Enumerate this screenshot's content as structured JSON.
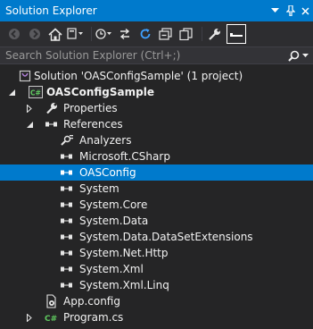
{
  "window": {
    "title": "Solution Explorer",
    "controls": [
      "dropdown-icon",
      "pin-icon",
      "close-icon"
    ]
  },
  "toolbar": {
    "buttons": [
      "back-icon",
      "forward-icon",
      "home-icon",
      "switch-views-icon",
      "pending-changes-filter-icon",
      "sync-icon",
      "refresh-icon",
      "collapse-all-icon",
      "show-all-files-icon",
      "properties-icon",
      "preview-icon"
    ]
  },
  "search": {
    "placeholder": "Search Solution Explorer (Ctrl+;)"
  },
  "tree": [
    {
      "label": "Solution 'OASConfigSample' (1 project)",
      "icon": "solution-icon",
      "level": 0,
      "expander": ""
    },
    {
      "label": "OASConfigSample",
      "icon": "csharp-project-icon",
      "level": 0,
      "expander": "expanded",
      "bold": true
    },
    {
      "label": "Properties",
      "icon": "wrench-icon",
      "level": 1,
      "expander": "collapsed"
    },
    {
      "label": "References",
      "icon": "references-icon",
      "level": 1,
      "expander": "expanded"
    },
    {
      "label": "Analyzers",
      "icon": "analyzers-icon",
      "level": 2,
      "expander": ""
    },
    {
      "label": "Microsoft.CSharp",
      "icon": "reference-icon",
      "level": 2,
      "expander": ""
    },
    {
      "label": "OASConfig",
      "icon": "reference-icon",
      "level": 2,
      "expander": "",
      "selected": true
    },
    {
      "label": "System",
      "icon": "reference-icon",
      "level": 2,
      "expander": ""
    },
    {
      "label": "System.Core",
      "icon": "reference-icon",
      "level": 2,
      "expander": ""
    },
    {
      "label": "System.Data",
      "icon": "reference-icon",
      "level": 2,
      "expander": ""
    },
    {
      "label": "System.Data.DataSetExtensions",
      "icon": "reference-icon",
      "level": 2,
      "expander": ""
    },
    {
      "label": "System.Net.Http",
      "icon": "reference-icon",
      "level": 2,
      "expander": ""
    },
    {
      "label": "System.Xml",
      "icon": "reference-icon",
      "level": 2,
      "expander": ""
    },
    {
      "label": "System.Xml.Linq",
      "icon": "reference-icon",
      "level": 2,
      "expander": ""
    },
    {
      "label": "App.config",
      "icon": "config-file-icon",
      "level": 1,
      "expander": ""
    },
    {
      "label": "Program.cs",
      "icon": "csharp-file-icon",
      "level": 1,
      "expander": "collapsed"
    }
  ],
  "colors": {
    "accent": "#007acc",
    "background": "#252526",
    "toolbar": "#2d2d30",
    "text": "#f1f1f1"
  }
}
